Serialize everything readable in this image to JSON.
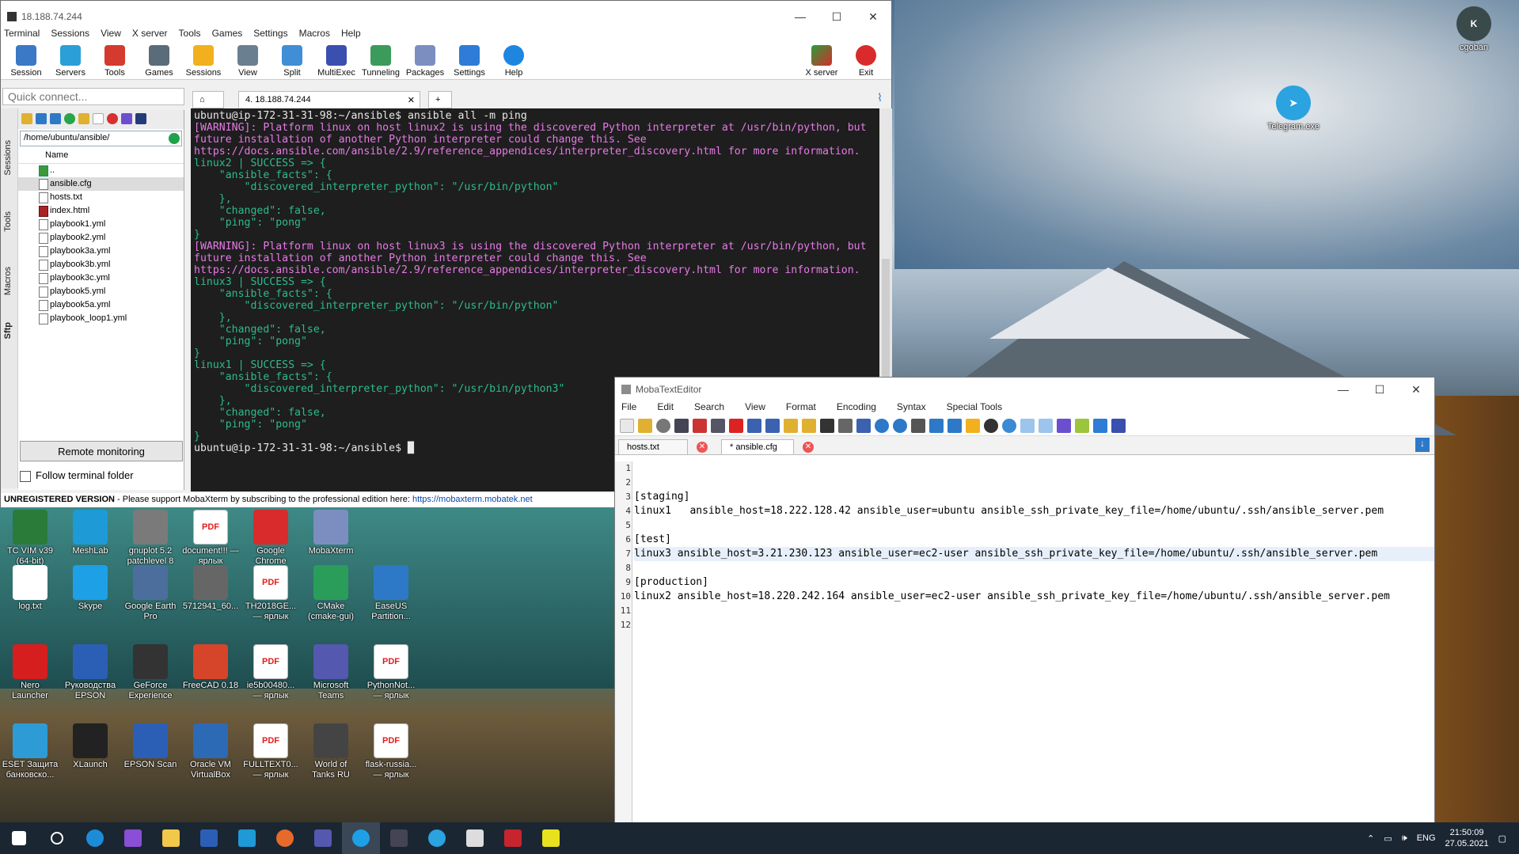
{
  "moba": {
    "title": "18.188.74.244",
    "menu": [
      "Terminal",
      "Sessions",
      "View",
      "X server",
      "Tools",
      "Games",
      "Settings",
      "Macros",
      "Help"
    ],
    "toolbar": [
      "Session",
      "Servers",
      "Tools",
      "Games",
      "Sessions",
      "View",
      "Split",
      "MultiExec",
      "Tunneling",
      "Packages",
      "Settings",
      "Help"
    ],
    "xserver_label": "X server",
    "exit_label": "Exit",
    "quick_connect_placeholder": "Quick connect...",
    "side_tabs": [
      "Sessions",
      "Tools",
      "Macros",
      "Sftp"
    ],
    "sftp_path": "/home/ubuntu/ansible/",
    "col_name": "Name",
    "files": [
      "..",
      "ansible.cfg",
      "hosts.txt",
      "index.html",
      "playbook1.yml",
      "playbook2.yml",
      "playbook3a.yml",
      "playbook3b.yml",
      "playbook3c.yml",
      "playbook5.yml",
      "playbook5a.yml",
      "playbook_loop1.yml"
    ],
    "remote_monitoring": "Remote monitoring",
    "follow_folder": "Follow terminal folder",
    "terminal_tab": "4. 18.188.74.244",
    "status_unreg": "UNREGISTERED VERSION",
    "status_text": " -  Please support MobaXterm by subscribing to the professional edition here: ",
    "status_link": "https://mobaxterm.mobatek.net",
    "terminal_lines": [
      {
        "c": "p",
        "t": "ubuntu@ip-172-31-31-98:~/ansible$ ansible all -m ping"
      },
      {
        "c": "w",
        "t": "[WARNING]: Platform linux on host linux2 is using the discovered Python interpreter at /usr/bin/python, but"
      },
      {
        "c": "w",
        "t": "future installation of another Python interpreter could change this. See"
      },
      {
        "c": "w",
        "t": "https://docs.ansible.com/ansible/2.9/reference_appendices/interpreter_discovery.html for more information."
      },
      {
        "c": "g",
        "t": "linux2 | SUCCESS => {"
      },
      {
        "c": "g",
        "t": "    \"ansible_facts\": {"
      },
      {
        "c": "g",
        "t": "        \"discovered_interpreter_python\": \"/usr/bin/python\""
      },
      {
        "c": "g",
        "t": "    },"
      },
      {
        "c": "g",
        "t": "    \"changed\": false,"
      },
      {
        "c": "g",
        "t": "    \"ping\": \"pong\""
      },
      {
        "c": "g",
        "t": "}"
      },
      {
        "c": "w",
        "t": "[WARNING]: Platform linux on host linux3 is using the discovered Python interpreter at /usr/bin/python, but"
      },
      {
        "c": "w",
        "t": "future installation of another Python interpreter could change this. See"
      },
      {
        "c": "w",
        "t": "https://docs.ansible.com/ansible/2.9/reference_appendices/interpreter_discovery.html for more information."
      },
      {
        "c": "g",
        "t": "linux3 | SUCCESS => {"
      },
      {
        "c": "g",
        "t": "    \"ansible_facts\": {"
      },
      {
        "c": "g",
        "t": "        \"discovered_interpreter_python\": \"/usr/bin/python\""
      },
      {
        "c": "g",
        "t": "    },"
      },
      {
        "c": "g",
        "t": "    \"changed\": false,"
      },
      {
        "c": "g",
        "t": "    \"ping\": \"pong\""
      },
      {
        "c": "g",
        "t": "}"
      },
      {
        "c": "g",
        "t": "linux1 | SUCCESS => {"
      },
      {
        "c": "g",
        "t": "    \"ansible_facts\": {"
      },
      {
        "c": "g",
        "t": "        \"discovered_interpreter_python\": \"/usr/bin/python3\""
      },
      {
        "c": "g",
        "t": "    },"
      },
      {
        "c": "g",
        "t": "    \"changed\": false,"
      },
      {
        "c": "g",
        "t": "    \"ping\": \"pong\""
      },
      {
        "c": "g",
        "t": "}"
      },
      {
        "c": "p",
        "t": "ubuntu@ip-172-31-31-98:~/ansible$ █"
      }
    ]
  },
  "editor": {
    "title": "MobaTextEditor",
    "menu": [
      "File",
      "Edit",
      "Search",
      "View",
      "Format",
      "Encoding",
      "Syntax",
      "Special Tools"
    ],
    "tabs": [
      "hosts.txt",
      "* ansible.cfg"
    ],
    "lines": [
      "",
      "",
      "[staging]",
      "linux1   ansible_host=18.222.128.42 ansible_user=ubuntu ansible_ssh_private_key_file=/home/ubuntu/.ssh/ansible_server.pem",
      "",
      "[test]",
      "linux3 ansible_host=3.21.230.123 ansible_user=ec2-user ansible_ssh_private_key_file=/home/ubuntu/.ssh/ansible_server.pem",
      "",
      "[production]",
      "linux2 ansible_host=18.220.242.164 ansible_user=ec2-user ansible_ssh_private_key_file=/home/ubuntu/.ssh/ansible_server.pem",
      "",
      ""
    ]
  },
  "desktop": {
    "top_right": [
      "cgoban",
      "Telegram.exe"
    ],
    "icons": [
      "TC VIM v39 (64-bit)",
      "MeshLab",
      "gnuplot 5.2 patchlevel 8",
      "document!!! — ярлык",
      "Google Chrome",
      "MobaXterm",
      "log.txt",
      "Skype",
      "Google Earth Pro",
      "5712941_60...",
      "TH2018GE... — ярлык",
      "CMake (cmake-gui)",
      "EaseUS Partition...",
      "Nero Launcher",
      "Руководства EPSON",
      "GeForce Experience",
      "FreeCAD 0.18",
      "ie5b00480... — ярлык",
      "Microsoft Teams",
      "PythonNot... — ярлык",
      "ESET Защита банковско...",
      "XLaunch",
      "EPSON Scan",
      "Oracle VM VirtualBox",
      "FULLTEXT0... — ярлык",
      "World of Tanks RU",
      "flask-russia... — ярлык"
    ]
  },
  "taskbar": {
    "lang": "ENG",
    "time": "21:50:09",
    "date": "27.05.2021"
  }
}
